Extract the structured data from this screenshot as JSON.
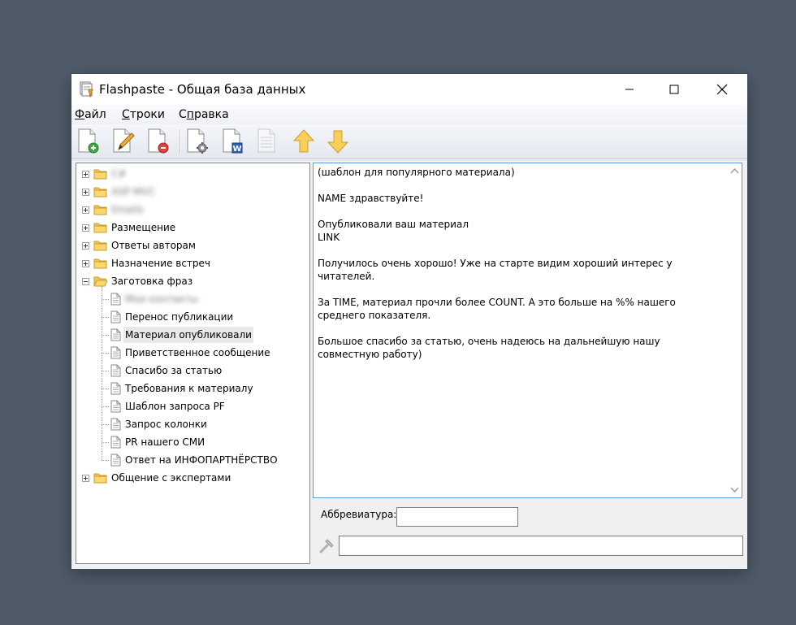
{
  "window": {
    "title": "Flashpaste - Общая база данных"
  },
  "menu": [
    {
      "label": "Файл",
      "mnemonic": "Ф",
      "rest": "айл"
    },
    {
      "label": "Строки",
      "mnemonic": "С",
      "rest": "троки"
    },
    {
      "label": "Справка",
      "mnemonic": "п",
      "rest": "равка",
      "prefix": "С"
    }
  ],
  "toolbar": {
    "buttons": [
      {
        "name": "new-item-button",
        "icon": "doc-add-icon"
      },
      {
        "name": "edit-item-button",
        "icon": "doc-edit-icon"
      },
      {
        "name": "delete-item-button",
        "icon": "doc-delete-icon"
      },
      {
        "name": "settings-button",
        "icon": "doc-gear-icon"
      },
      {
        "name": "word-export-button",
        "icon": "doc-word-icon"
      },
      {
        "name": "text-view-button",
        "icon": "doc-lines-icon",
        "disabled": true
      },
      {
        "name": "move-up-button",
        "icon": "arrow-up-icon"
      },
      {
        "name": "move-down-button",
        "icon": "arrow-down-icon"
      }
    ]
  },
  "tree": {
    "folders": [
      {
        "label": "C#",
        "expanded": false,
        "blurred": true
      },
      {
        "label": "ASP MVC",
        "expanded": false,
        "blurred": true
      },
      {
        "label": "Emails",
        "expanded": false,
        "blurred": true
      },
      {
        "label": "Размещение",
        "expanded": false
      },
      {
        "label": "Ответы авторам",
        "expanded": false
      },
      {
        "label": "Назначение встреч",
        "expanded": false
      },
      {
        "label": "Заготовка фраз",
        "expanded": true
      }
    ],
    "children": [
      {
        "label": "Мои контакты",
        "blurred": true
      },
      {
        "label": "Перенос публикации"
      },
      {
        "label": "Материал опубликовали",
        "selected": true
      },
      {
        "label": "Приветственное сообщение"
      },
      {
        "label": "Спасибо за статью"
      },
      {
        "label": "Требования к материалу"
      },
      {
        "label": "Шаблон запроса PF"
      },
      {
        "label": "Запрос колонки"
      },
      {
        "label": "PR нашего СМИ"
      },
      {
        "label": "Ответ на ИНФОПАРТНЁРСТВО"
      }
    ],
    "last_folder": {
      "label": "Общение с экспертами",
      "expanded": false
    }
  },
  "editor": {
    "text": "(шаблон для популярного материала)\n\nNAME здравствуйте!\n\nОпубликовали ваш материал\nLINK\n\nПолучилось очень хорошо! Уже на старте видим хороший интерес у читателей.\n\nЗа TIME, материал прочли более COUNT. А это больше на %% нашего среднего показателя.\n\nБольшое спасибо за статью, очень надеюсь на дальнейшую нашу совместную работу)"
  },
  "abbreviation": {
    "label": "Аббревиатура:",
    "value": ""
  },
  "bottom_field": {
    "value": ""
  },
  "colors": {
    "accent": "#569de5",
    "folder": "#f3c85a",
    "arrow": "#f6c342"
  }
}
